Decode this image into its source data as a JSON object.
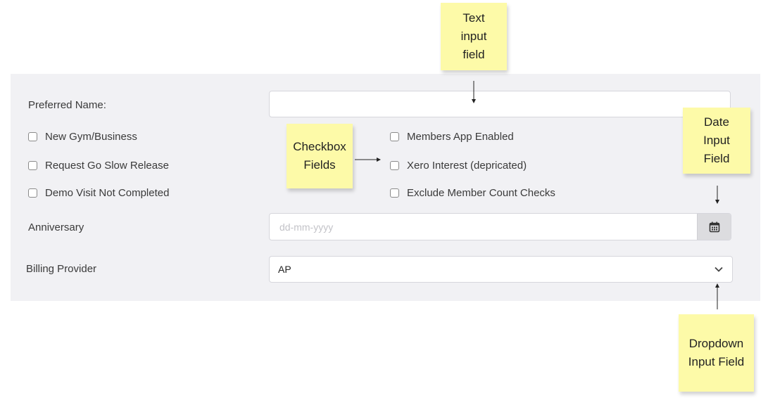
{
  "form": {
    "preferred_name_label": "Preferred Name:",
    "preferred_name_value": "",
    "checkboxes_left": [
      {
        "label": "New Gym/Business",
        "checked": false
      },
      {
        "label": "Request Go Slow Release",
        "checked": false
      },
      {
        "label": "Demo Visit Not Completed",
        "checked": false
      }
    ],
    "checkboxes_right": [
      {
        "label": "Members App Enabled",
        "checked": false
      },
      {
        "label": "Xero Interest (depricated)",
        "checked": false
      },
      {
        "label": "Exclude Member Count Checks",
        "checked": false
      }
    ],
    "anniversary_label": "Anniversary",
    "anniversary_placeholder": "dd-mm-yyyy",
    "billing_provider_label": "Billing Provider",
    "billing_provider_value": "AP"
  },
  "annotations": {
    "text_input": "Text\ninput\nfield",
    "checkbox_fields": "Checkbox\nFields",
    "date_input": "Date\nInput\nField",
    "dropdown_input": "Dropdown\nInput Field"
  },
  "icons": {
    "calendar": "calendar-icon",
    "dropdown": "chevron-down-icon"
  },
  "colors": {
    "panel_bg": "#f1f1f4",
    "sticky_note": "#fdfaa8",
    "calendar_button_bg": "#dcdcdf"
  }
}
